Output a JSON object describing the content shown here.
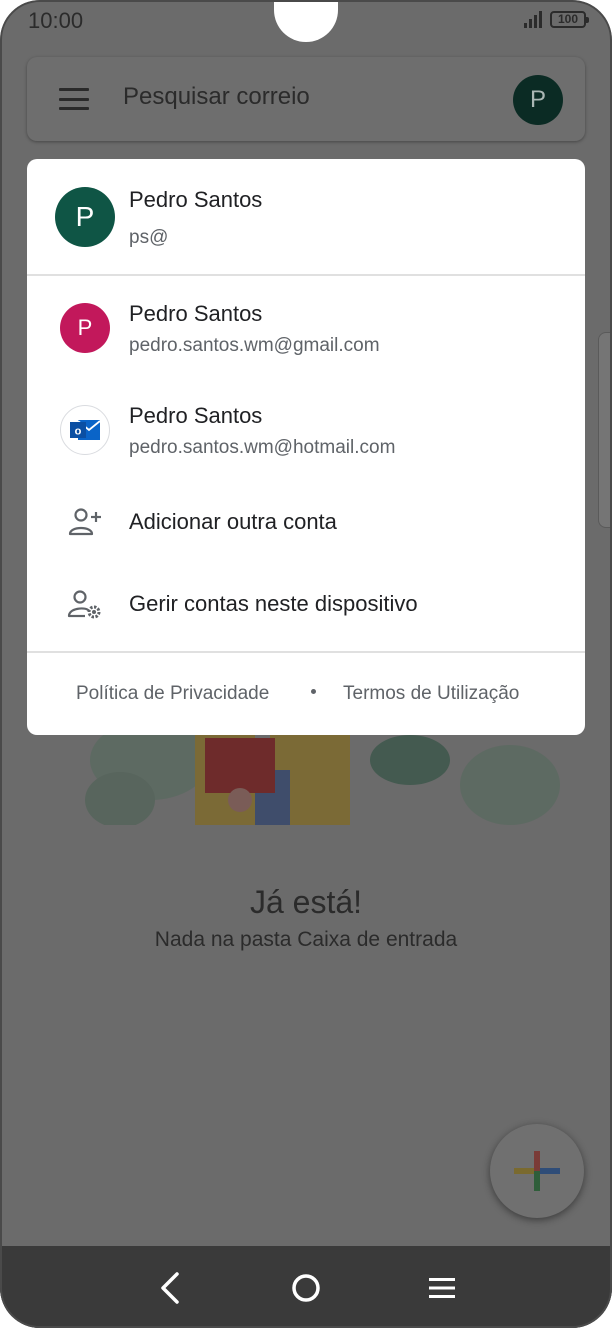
{
  "status_bar": {
    "time": "10:00",
    "battery": "100"
  },
  "search": {
    "placeholder": "Pesquisar correio",
    "avatar_letter": "P"
  },
  "inbox_empty": {
    "title": "Já está!",
    "subtitle": "Nada na pasta Caixa de entrada"
  },
  "account_menu": {
    "current": {
      "name": "Pedro Santos",
      "email": "ps@",
      "avatar_letter": "P"
    },
    "accounts": [
      {
        "name": "Pedro Santos",
        "email": "pedro.santos.wm@gmail.com",
        "avatar_letter": "P"
      },
      {
        "name": "Pedro Santos",
        "email": "pedro.santos.wm@hotmail.com",
        "icon": "outlook-icon"
      }
    ],
    "actions": [
      {
        "label": "Adicionar outra conta",
        "icon": "add-person-icon"
      },
      {
        "label": "Gerir contas neste dispositivo",
        "icon": "manage-accounts-icon"
      }
    ],
    "footer": {
      "privacy": "Política de Privacidade",
      "terms": "Termos de Utilização"
    }
  },
  "colors": {
    "current_avatar": "#0f5545",
    "gmail_avatar": "#c2185b",
    "outlook_blue": "#0a64c8",
    "scrim": "#6b6b6b"
  }
}
